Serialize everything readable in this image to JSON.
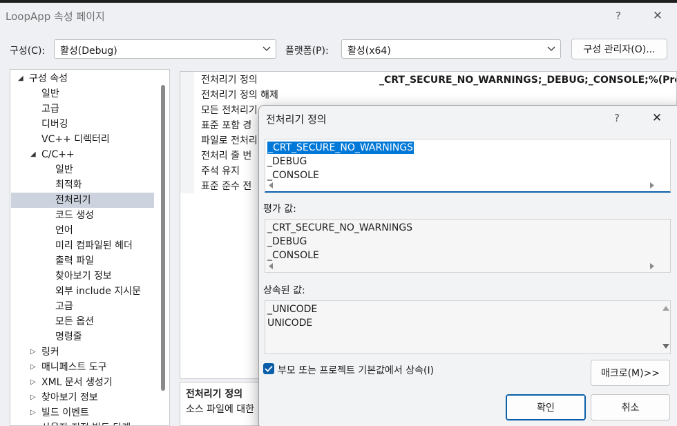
{
  "window": {
    "title": "LoopApp 속성 페이지",
    "help_glyph": "?",
    "close_glyph": "✕"
  },
  "config_bar": {
    "config_label": "구성(C):",
    "config_value": "활성(Debug)",
    "platform_label": "플랫폼(P):",
    "platform_value": "활성(x64)",
    "manager_button": "구성 관리자(O)..."
  },
  "tree": {
    "items": [
      {
        "label": "구성 속성",
        "level": 0,
        "twisty": "◢"
      },
      {
        "label": "일반",
        "level": 1
      },
      {
        "label": "고급",
        "level": 1
      },
      {
        "label": "디버깅",
        "level": 1
      },
      {
        "label": "VC++ 디렉터리",
        "level": 1
      },
      {
        "label": "C/C++",
        "level": 1,
        "twisty": "◢"
      },
      {
        "label": "일반",
        "level": 2
      },
      {
        "label": "최적화",
        "level": 2
      },
      {
        "label": "전처리기",
        "level": 2,
        "selected": true
      },
      {
        "label": "코드 생성",
        "level": 2
      },
      {
        "label": "언어",
        "level": 2
      },
      {
        "label": "미리 컴파일된 헤더",
        "level": 2
      },
      {
        "label": "출력 파일",
        "level": 2
      },
      {
        "label": "찾아보기 정보",
        "level": 2
      },
      {
        "label": "외부 include 지시문",
        "level": 2
      },
      {
        "label": "고급",
        "level": 2
      },
      {
        "label": "모든 옵션",
        "level": 2
      },
      {
        "label": "명령줄",
        "level": 2
      },
      {
        "label": "링커",
        "level": 1,
        "twisty": "▷"
      },
      {
        "label": "매니페스트 도구",
        "level": 1,
        "twisty": "▷"
      },
      {
        "label": "XML 문서 생성기",
        "level": 1,
        "twisty": "▷"
      },
      {
        "label": "찾아보기 정보",
        "level": 1,
        "twisty": "▷"
      },
      {
        "label": "빌드 이벤트",
        "level": 1,
        "twisty": "▷"
      },
      {
        "label": "사용자 지정 빌드 단계",
        "level": 1,
        "twisty": "▷"
      }
    ]
  },
  "grid": {
    "rows": [
      {
        "name": "전처리기 정의",
        "value": "_CRT_SECURE_NO_WARNINGS;_DEBUG;_CONSOLE;%(PreprocessorDefinitions)"
      },
      {
        "name": "전처리기 정의 해제",
        "value": ""
      },
      {
        "name": "모든 전처리기",
        "value": ""
      },
      {
        "name": "표준 포함 경",
        "value": ""
      },
      {
        "name": "파일로 전처리",
        "value": ""
      },
      {
        "name": "전처리 줄 번",
        "value": ""
      },
      {
        "name": "주석 유지",
        "value": ""
      },
      {
        "name": "표준 준수 전",
        "value": ""
      }
    ]
  },
  "description": {
    "title": "전처리기 정의",
    "text": "소스 파일에 대한"
  },
  "dialog": {
    "title": "전처리기 정의",
    "help_glyph": "?",
    "close_glyph": "✕",
    "edit_lines": [
      "_CRT_SECURE_NO_WARNINGS",
      "_DEBUG",
      "_CONSOLE"
    ],
    "evaluated_label": "평가 값:",
    "evaluated_lines": [
      "_CRT_SECURE_NO_WARNINGS",
      "_DEBUG",
      "_CONSOLE"
    ],
    "inherited_label": "상속된 값:",
    "inherited_lines": [
      "_UNICODE",
      "UNICODE"
    ],
    "inherit_checkbox": "부모 또는 프로젝트 기본값에서 상속(I)",
    "inherit_checked": true,
    "macro_button": "매크로(M)>>",
    "ok_button": "확인",
    "cancel_button": "취소"
  },
  "colors": {
    "accent": "#0a5ea8",
    "selection": "#0078d7",
    "tree_selection": "#ccd3df"
  }
}
